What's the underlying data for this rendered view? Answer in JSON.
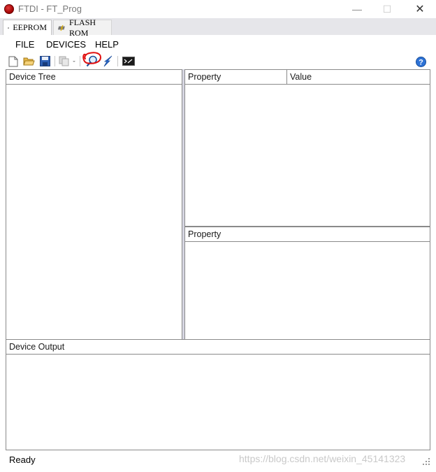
{
  "window": {
    "title": "FTDI - FT_Prog",
    "minimize_glyph": "—",
    "maximize_glyph": "☐",
    "close_glyph": "✕"
  },
  "tabs": [
    {
      "label": "EEPROM",
      "icon": "chip-icon",
      "active": true
    },
    {
      "label": "FLASH ROM",
      "icon": "flash-chip-icon",
      "active": false
    }
  ],
  "menu": {
    "file": "FILE",
    "devices": "DEVICES",
    "help": "HELP"
  },
  "toolbar": {
    "buttons": [
      "new-file-icon",
      "open-folder-icon",
      "save-icon",
      "copy-icon",
      "search-devices-icon",
      "program-devices-icon",
      "command-window-icon",
      "help-icon"
    ]
  },
  "panels": {
    "device_tree": "Device Tree",
    "property_1": "Property",
    "value": "Value",
    "property_2": "Property",
    "device_output": "Device Output"
  },
  "status": {
    "text": "Ready",
    "watermark": "https://blog.csdn.net/weixin_45141323"
  },
  "colors": {
    "annotation": "#e01010",
    "panel_border": "#8a8a8a",
    "splitter": "#d6d6e2"
  }
}
